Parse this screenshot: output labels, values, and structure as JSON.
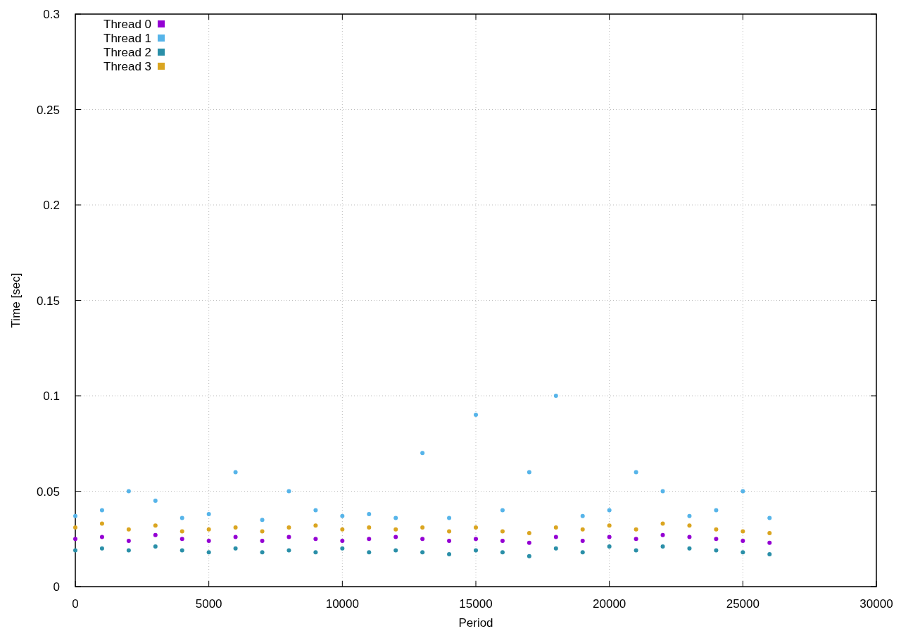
{
  "chart_data": {
    "type": "scatter",
    "xlabel": "Period",
    "ylabel": "Time [sec]",
    "grid": true,
    "legend": "top-left",
    "x": [
      0,
      1000,
      2000,
      3000,
      4000,
      5000,
      6000,
      7000,
      8000,
      9000,
      10000,
      11000,
      12000,
      13000,
      14000,
      15000,
      16000,
      17000,
      18000,
      19000,
      20000,
      21000,
      22000,
      23000,
      24000,
      25000,
      26000
    ],
    "series": [
      {
        "name": "Thread 0",
        "color": "#9400d3",
        "values": [
          0.025,
          0.026,
          0.024,
          0.027,
          0.025,
          0.024,
          0.026,
          0.024,
          0.026,
          0.025,
          0.024,
          0.025,
          0.026,
          0.025,
          0.024,
          0.025,
          0.024,
          0.023,
          0.026,
          0.024,
          0.026,
          0.025,
          0.027,
          0.026,
          0.025,
          0.024,
          0.023
        ]
      },
      {
        "name": "Thread 1",
        "color": "#56b4e9",
        "values": [
          0.037,
          0.04,
          0.05,
          0.045,
          0.036,
          0.038,
          0.06,
          0.035,
          0.05,
          0.04,
          0.037,
          0.038,
          0.036,
          0.07,
          0.036,
          0.09,
          0.04,
          0.06,
          0.1,
          0.037,
          0.04,
          0.06,
          0.05,
          0.037,
          0.04,
          0.05,
          0.036
        ]
      },
      {
        "name": "Thread 2",
        "color": "#2a8fa8",
        "values": [
          0.019,
          0.02,
          0.019,
          0.021,
          0.019,
          0.018,
          0.02,
          0.018,
          0.019,
          0.018,
          0.02,
          0.018,
          0.019,
          0.018,
          0.017,
          0.019,
          0.018,
          0.016,
          0.02,
          0.018,
          0.021,
          0.019,
          0.021,
          0.02,
          0.019,
          0.018,
          0.017
        ]
      },
      {
        "name": "Thread 3",
        "color": "#daa520",
        "values": [
          0.031,
          0.033,
          0.03,
          0.032,
          0.029,
          0.03,
          0.031,
          0.029,
          0.031,
          0.032,
          0.03,
          0.031,
          0.03,
          0.031,
          0.029,
          0.031,
          0.029,
          0.028,
          0.031,
          0.03,
          0.032,
          0.03,
          0.033,
          0.032,
          0.03,
          0.029,
          0.028
        ]
      }
    ],
    "xlim": [
      0,
      30000
    ],
    "ylim": [
      0,
      0.3
    ],
    "xticks": [
      0,
      5000,
      10000,
      15000,
      20000,
      25000,
      30000
    ],
    "yticks": [
      0,
      0.05,
      0.1,
      0.15,
      0.2,
      0.25,
      0.3
    ]
  }
}
